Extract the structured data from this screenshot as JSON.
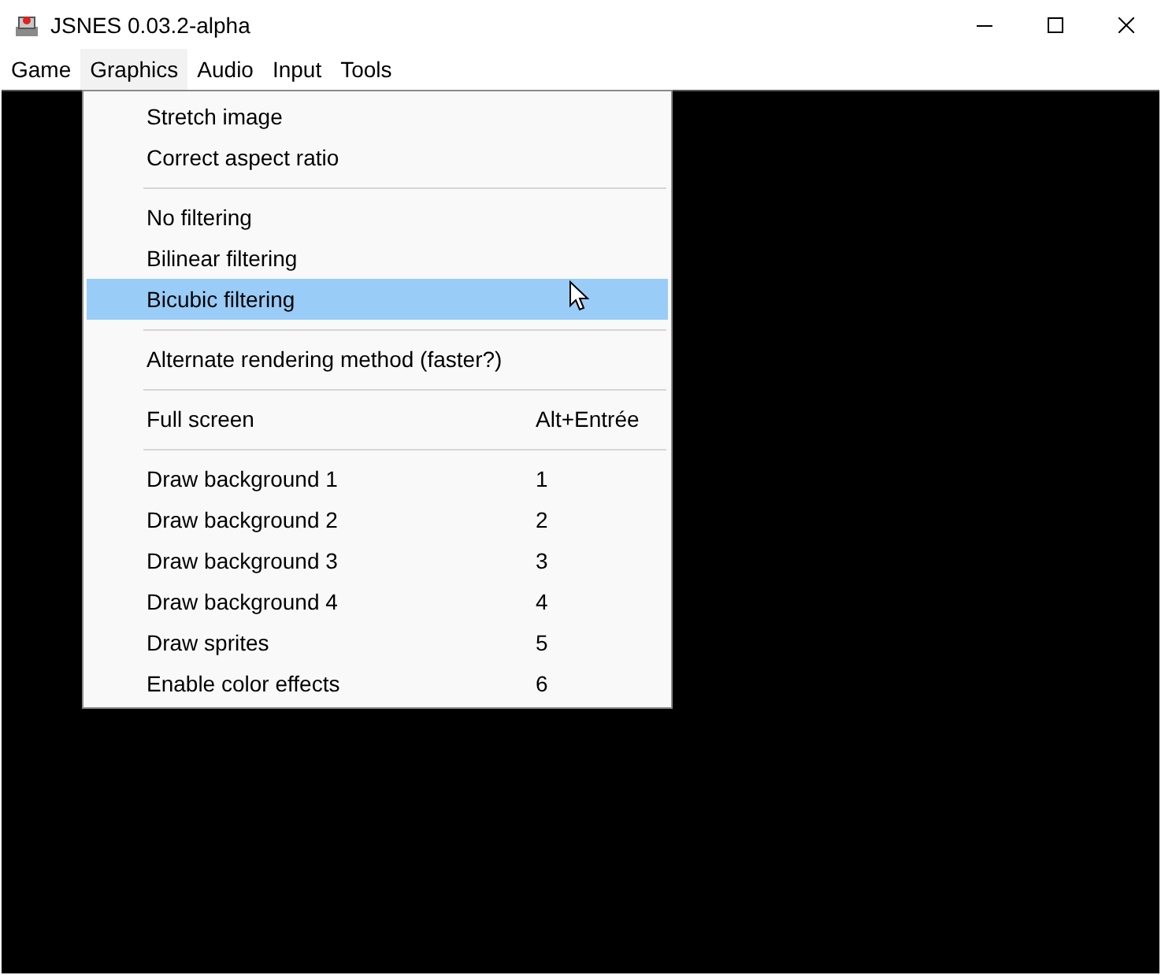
{
  "window": {
    "title": "JSNES 0.03.2-alpha"
  },
  "menubar": [
    {
      "label": "Game",
      "selected": false
    },
    {
      "label": "Graphics",
      "selected": true
    },
    {
      "label": "Audio",
      "selected": false
    },
    {
      "label": "Input",
      "selected": false
    },
    {
      "label": "Tools",
      "selected": false
    }
  ],
  "menu": [
    {
      "kind": "item",
      "label": "Stretch image",
      "selected": false
    },
    {
      "kind": "item",
      "label": "Correct aspect ratio",
      "selected": false
    },
    {
      "kind": "separator"
    },
    {
      "kind": "item",
      "label": "No filtering",
      "selected": false
    },
    {
      "kind": "item",
      "label": "Bilinear filtering",
      "selected": false
    },
    {
      "kind": "item",
      "label": "Bicubic filtering",
      "selected": true
    },
    {
      "kind": "separator"
    },
    {
      "kind": "item",
      "label": "Alternate rendering method (faster?)",
      "selected": false
    },
    {
      "kind": "separator"
    },
    {
      "kind": "item",
      "label": "Full screen",
      "shortcut": "Alt+Entrée",
      "selected": false
    },
    {
      "kind": "separator"
    },
    {
      "kind": "item",
      "label": "Draw background 1",
      "shortcut": "1",
      "selected": false
    },
    {
      "kind": "item",
      "label": "Draw background 2",
      "shortcut": "2",
      "selected": false
    },
    {
      "kind": "item",
      "label": "Draw background 3",
      "shortcut": "3",
      "selected": false
    },
    {
      "kind": "item",
      "label": "Draw background 4",
      "shortcut": "4",
      "selected": false
    },
    {
      "kind": "item",
      "label": "Draw sprites",
      "shortcut": "5",
      "selected": false
    },
    {
      "kind": "item",
      "label": "Enable color effects",
      "shortcut": "6",
      "selected": false
    }
  ]
}
